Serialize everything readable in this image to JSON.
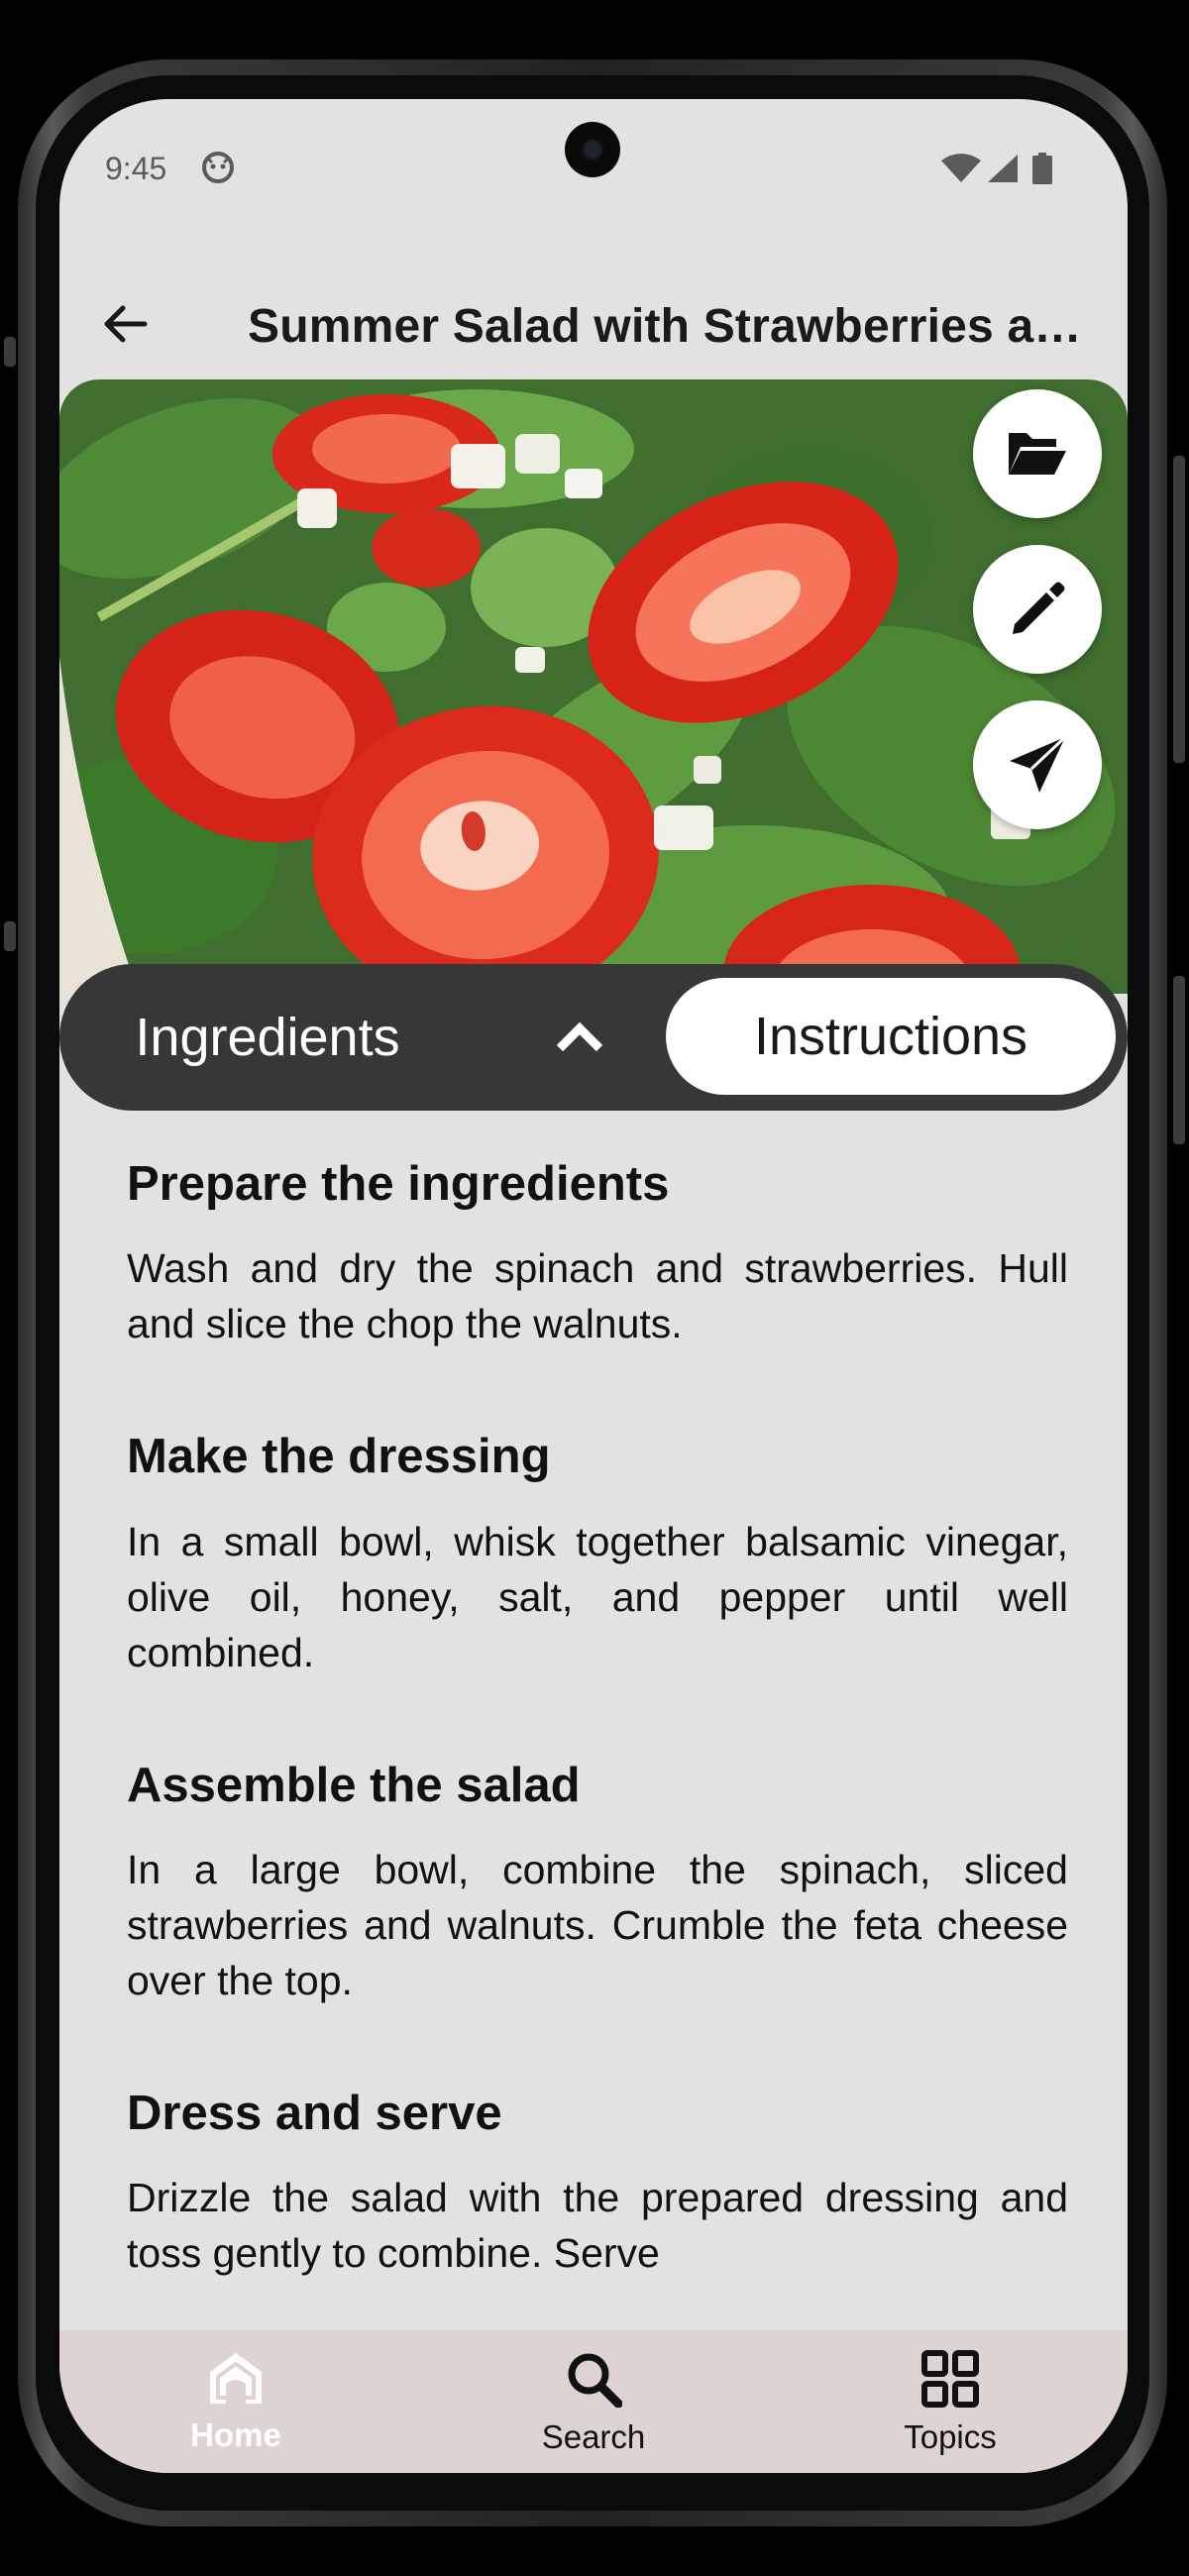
{
  "status_bar": {
    "time": "9:45"
  },
  "header": {
    "title": "Summer Salad with Strawberries and Spinach",
    "back_icon": "arrow-left-icon"
  },
  "hero": {
    "image_subject": "strawberry spinach salad photo",
    "actions": [
      {
        "icon": "folder-open-icon"
      },
      {
        "icon": "pencil-icon"
      },
      {
        "icon": "send-icon"
      }
    ]
  },
  "tabs": {
    "ingredients_label": "Ingredients",
    "instructions_label": "Instructions",
    "selected": "Instructions",
    "toggle_icon": "chevron-up-icon"
  },
  "instructions": [
    {
      "title": "Prepare the ingredients",
      "text": "Wash and dry the spinach and strawberries. Hull and slice the  chop the walnuts."
    },
    {
      "title": "Make the dressing",
      "text": "In a small bowl, whisk together balsamic vinegar, olive oil, honey, salt, and pepper until well combined."
    },
    {
      "title": "Assemble the salad",
      "text": "In a large bowl, combine the spinach, sliced strawberries and walnuts. Crumble the feta cheese over the top."
    },
    {
      "title": "Dress and serve",
      "text": "Drizzle the salad with the prepared dressing and toss gently to combine. Serve"
    }
  ],
  "bottom_nav": {
    "items": [
      {
        "label": "Home",
        "icon": "home-icon",
        "active": true
      },
      {
        "label": "Search",
        "icon": "search-icon",
        "active": false
      },
      {
        "label": "Topics",
        "icon": "grid-icon",
        "active": false
      }
    ]
  },
  "colors": {
    "screen_bg": "#e2e2e2",
    "segment_bg": "#373737",
    "bottom_nav_bg": "#ddd3d2",
    "text": "#111111"
  }
}
